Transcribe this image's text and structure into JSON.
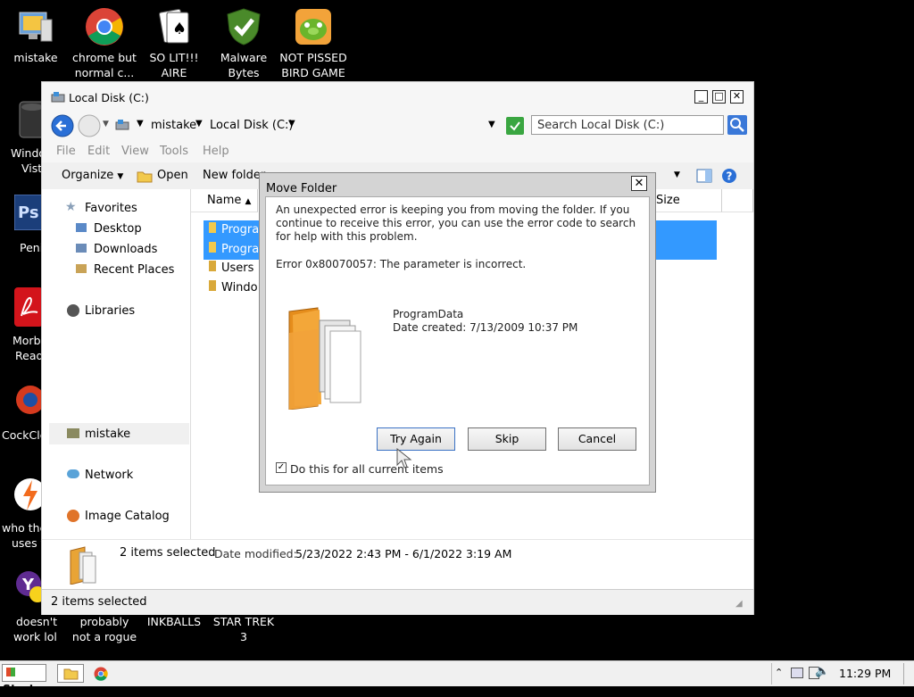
{
  "desktop": {
    "icons": [
      {
        "label1": "mistake",
        "label2": ""
      },
      {
        "label1": "chrome but",
        "label2": "normal c..."
      },
      {
        "label1": "SO LIT!!!",
        "label2": "AIRE"
      },
      {
        "label1": "Malware",
        "label2": "Bytes"
      },
      {
        "label1": "NOT PISSED",
        "label2": "BIRD GAME"
      }
    ],
    "left_labels": [
      "Windo",
      "Vist",
      "Peni",
      "Morb",
      "Read",
      "CockCle",
      "who the",
      "uses t",
      "doesn't",
      "work lol"
    ],
    "bottom_labels": [
      {
        "label1": "probably",
        "label2": "not a rogue"
      },
      {
        "label1": "INKBALLS",
        "label2": ""
      },
      {
        "label1": "STAR TREK",
        "label2": "3"
      }
    ]
  },
  "explorer": {
    "title": "Local Disk (C:)",
    "breadcrumb": [
      "mistake",
      "Local Disk (C:)"
    ],
    "search_placeholder": "Search Local Disk (C:)",
    "menu": [
      "File",
      "Edit",
      "View",
      "Tools",
      "Help"
    ],
    "toolbar": {
      "organize": "Organize",
      "open": "Open",
      "new_folder": "New folder"
    },
    "nav": {
      "favorites": "Favorites",
      "favorites_items": [
        "Desktop",
        "Downloads",
        "Recent Places"
      ],
      "libraries": "Libraries",
      "homegroup": "mistake",
      "network": "Network",
      "image_catalog": "Image Catalog"
    },
    "columns": {
      "name": "Name",
      "size": "Size"
    },
    "files": [
      "Progra",
      "Progra",
      "Users",
      "Windo"
    ],
    "details": {
      "count": "2 items selected",
      "date_modified_label": "Date modified:",
      "date_range": "5/23/2022 2:43 PM - 6/1/2022 3:19 AM"
    },
    "status": "2 items selected"
  },
  "dialog": {
    "title": "Move Folder",
    "message": "An unexpected error is keeping you from moving the folder. If you continue to receive this error, you can use the error code to search for help with this problem.",
    "error": "Error 0x80070057: The parameter is incorrect.",
    "item_name": "ProgramData",
    "item_date": "Date created: 7/13/2009 10:37 PM",
    "buttons": {
      "try_again": "Try Again",
      "skip": "Skip",
      "cancel": "Cancel"
    },
    "checkbox_label": "Do this for all current items",
    "checkbox_checked": true
  },
  "taskbar": {
    "start": "Start",
    "clock": "11:29 PM"
  },
  "colors": {
    "selection": "#3399ff",
    "accent": "#2a6fd6"
  }
}
